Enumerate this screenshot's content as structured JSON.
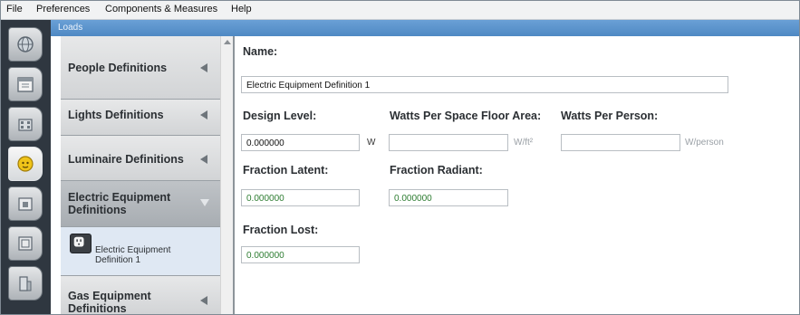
{
  "menu": {
    "file": "File",
    "preferences": "Preferences",
    "components": "Components & Measures",
    "help": "Help"
  },
  "title": "Loads",
  "sidebar_tabs": [
    {
      "icon": "globe-icon"
    },
    {
      "icon": "calendar-icon"
    },
    {
      "icon": "building-icon"
    },
    {
      "icon": "loads-icon",
      "active": true
    },
    {
      "icon": "space-type-icon"
    },
    {
      "icon": "thermal-zone-icon"
    },
    {
      "icon": "geometry-icon"
    }
  ],
  "definitions": {
    "people": "People Definitions",
    "lights": "Lights Definitions",
    "luminaire": "Luminaire Definitions",
    "electric": "Electric Equipment Definitions",
    "electric_child": "Electric Equipment Definition 1",
    "gas": "Gas Equipment Definitions"
  },
  "form": {
    "name_label": "Name:",
    "name_value": "Electric Equipment Definition 1",
    "design_level_label": "Design Level:",
    "design_level_value": "0.000000",
    "design_level_unit": "W",
    "watts_area_label": "Watts Per Space Floor Area:",
    "watts_area_value": "",
    "watts_area_unit": "W/ft²",
    "watts_person_label": "Watts Per Person:",
    "watts_person_value": "",
    "watts_person_unit": "W/person",
    "fraction_latent_label": "Fraction Latent:",
    "fraction_latent_value": "0.000000",
    "fraction_radiant_label": "Fraction Radiant:",
    "fraction_radiant_value": "0.000000",
    "fraction_lost_label": "Fraction Lost:",
    "fraction_lost_value": "0.000000"
  },
  "colors": {
    "title_bar": "#5a93cc",
    "icon_strip": "#2f3740",
    "green_value": "#2e7d32"
  }
}
